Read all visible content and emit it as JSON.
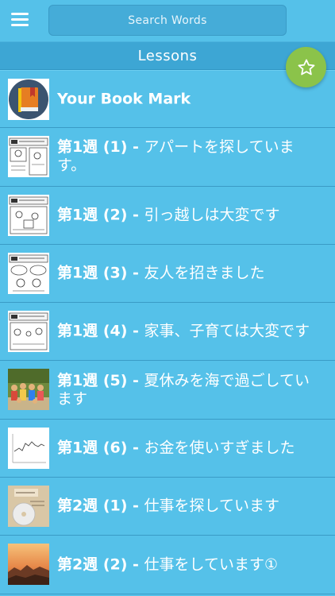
{
  "header": {
    "search_placeholder": "Search Words",
    "section_title": "Lessons"
  },
  "lessons": [
    {
      "prefix": "",
      "title": "Your Book Mark",
      "thumb": "bookmark-book-icon"
    },
    {
      "prefix": "第1週 (1) - ",
      "title": "アパートを探しています。",
      "thumb": "lesson-illustration"
    },
    {
      "prefix": "第1週 (2) - ",
      "title": "引っ越しは大変です",
      "thumb": "lesson-illustration"
    },
    {
      "prefix": "第1週 (3) - ",
      "title": "友人を招きました",
      "thumb": "lesson-illustration"
    },
    {
      "prefix": "第1週 (4) - ",
      "title": "家事、子育ては大変です",
      "thumb": "lesson-illustration"
    },
    {
      "prefix": "第1週 (5) - ",
      "title": "夏休みを海で過ごしています",
      "thumb": "group-photo"
    },
    {
      "prefix": "第1週 (6) - ",
      "title": "お金を使いすぎました",
      "thumb": "line-graph"
    },
    {
      "prefix": "第2週 (1) - ",
      "title": "仕事を探しています",
      "thumb": "cd-photo"
    },
    {
      "prefix": "第2週 (2) - ",
      "title": "仕事をしています①",
      "thumb": "sunset-photo"
    }
  ],
  "colors": {
    "background": "#55c1e9",
    "header_bar": "#3da6d4",
    "fab": "#8bc34a"
  }
}
